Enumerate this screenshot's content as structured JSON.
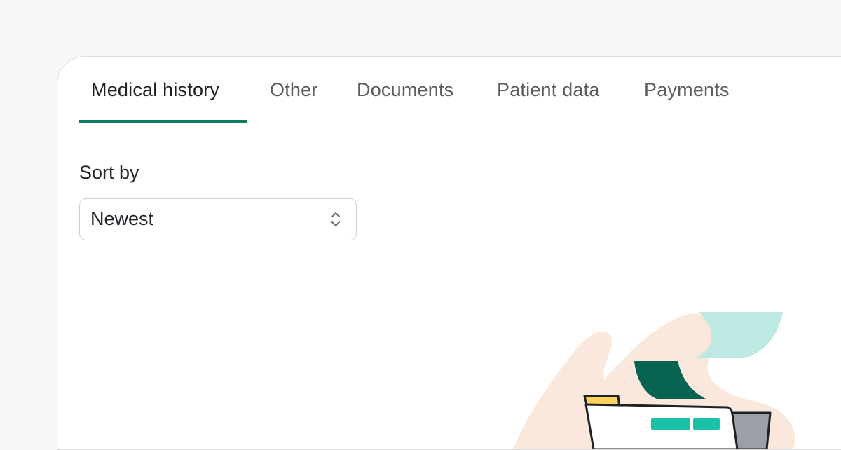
{
  "tabs": [
    {
      "label": "Medical history",
      "active": true
    },
    {
      "label": "Other",
      "active": false
    },
    {
      "label": "Documents",
      "active": false
    },
    {
      "label": "Patient data",
      "active": false
    },
    {
      "label": "Payments",
      "active": false
    }
  ],
  "sort": {
    "label": "Sort by",
    "selected": "Newest"
  },
  "colors": {
    "accent": "#0e7a60",
    "blob": "#fbe8dd",
    "mint": "#bde9e2",
    "dark_green": "#05634f",
    "teal": "#19c2a6",
    "yellow": "#fbd15a",
    "gray_folder": "#9aa0a6"
  },
  "icons": {
    "select_chevron": "chevron-up-down-icon",
    "illustration": "empty-folder-illustration"
  }
}
